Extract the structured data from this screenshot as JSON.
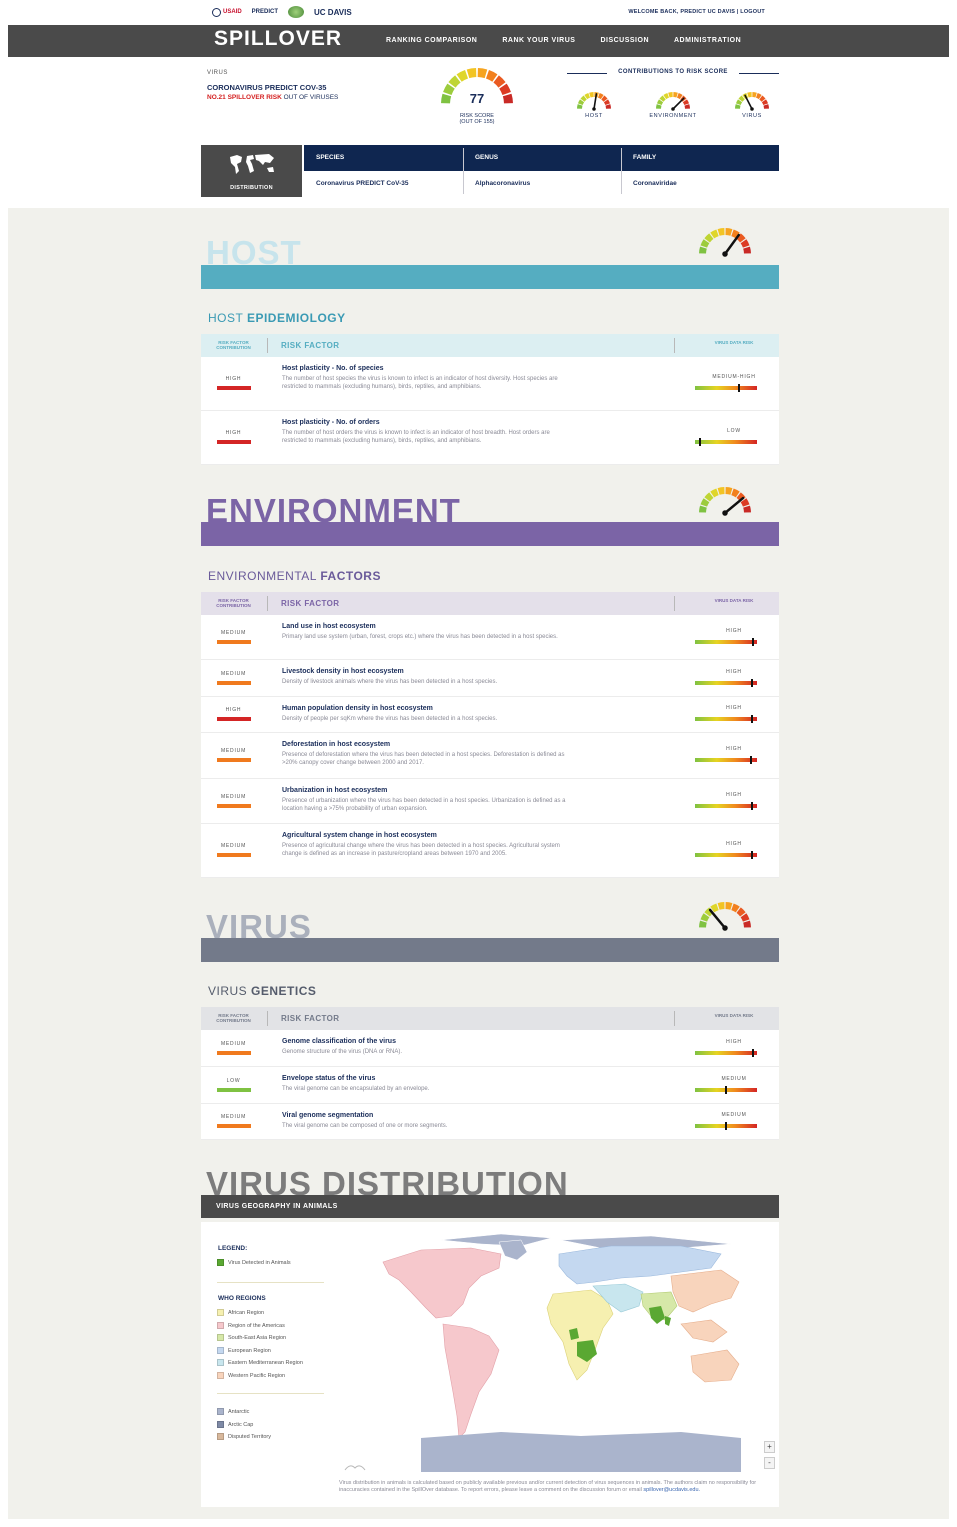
{
  "top": {
    "logos": [
      "USAID",
      "PREDICT",
      "UC DAVIS"
    ],
    "welcome": "WELCOME BACK, PREDICT UC DAVIS  |  LOGOUT"
  },
  "nav": {
    "brand": "SPILLOVER",
    "links": [
      "RANKING COMPARISON",
      "RANK YOUR VIRUS",
      "DISCUSSION",
      "ADMINISTRATION"
    ]
  },
  "virus": {
    "label": "VIRUS",
    "name": "CORONAVIRUS PREDICT COV-35",
    "rank_prefix": "NO.21 SPILLOVER RISK",
    "rank_suffix": " OUT OF VIRUSES",
    "score": "77",
    "score_label_1": "RISK SCORE",
    "score_label_2": "(OUT OF 155)"
  },
  "contributions": {
    "title": "CONTRIBUTIONS TO RISK SCORE",
    "items": [
      "HOST",
      "ENVIRONMENT",
      "VIRUS"
    ]
  },
  "taxonomy": {
    "distribution_label": "DISTRIBUTION",
    "headers": [
      "SPECIES",
      "GENUS",
      "FAMILY"
    ],
    "values": [
      "Coronavirus PREDICT CoV-35",
      "Alphacoronavirus",
      "Coronaviridae"
    ]
  },
  "table_headers": {
    "contribution": "RISK FACTOR CONTRIBUTION",
    "factor": "RISK FACTOR",
    "data_risk": "VIRUS DATA RISK"
  },
  "colors": {
    "host": "#55adc1",
    "environment": "#7b64a6",
    "virus": "#737a8a",
    "high": "#d42525",
    "medium": "#f07a1e",
    "low": "#7fc242"
  },
  "host": {
    "title": "HOST",
    "sub_a": "HOST ",
    "sub_b": "EPIDEMIOLOGY",
    "rows": [
      {
        "level": "HIGH",
        "title": "Host plasticity - No. of species",
        "desc": "The number of host species the virus is known to infect is an indicator of host diversity. Host species are restricted to mammals (excluding humans), birds, reptiles, and amphibians.",
        "risk": "MEDIUM-HIGH",
        "risk_value": 0.72
      },
      {
        "level": "HIGH",
        "title": "Host plasticity - No. of orders",
        "desc": "The number of host orders the virus is known to infect is an indicator of host breadth. Host orders are restricted to mammals (excluding humans), birds, reptiles, and amphibians.",
        "risk": "LOW",
        "risk_value": 0.06
      }
    ]
  },
  "environment": {
    "title": "ENVIRONMENT",
    "sub_a": "ENVIRONMENTAL ",
    "sub_b": "FACTORS",
    "rows": [
      {
        "level": "MEDIUM",
        "title": "Land use in host ecosystem",
        "desc": "Primary land use system (urban, forest, crops etc.) where the virus has been detected in a host species.",
        "risk": "HIGH",
        "risk_value": 0.95
      },
      {
        "level": "MEDIUM",
        "title": "Livestock density in host ecosystem",
        "desc": "Density of livestock animals where the virus has been detected in a host species.",
        "risk": "HIGH",
        "risk_value": 0.93
      },
      {
        "level": "HIGH",
        "title": "Human population density in host ecosystem",
        "desc": "Density of people per sqKm where the virus has been detected in a host species.",
        "risk": "HIGH",
        "risk_value": 0.94
      },
      {
        "level": "MEDIUM",
        "title": "Deforestation in host ecosystem",
        "desc": "Presence of deforestation where the virus has been detected in a host species. Deforestation is defined as >20% canopy cover change between 2000 and 2017.",
        "risk": "HIGH",
        "risk_value": 0.92
      },
      {
        "level": "MEDIUM",
        "title": "Urbanization in host ecosystem",
        "desc": "Presence of urbanization where the virus has been detected in a host species. Urbanization is defined as a location having a >75% probability of urban expansion.",
        "risk": "HIGH",
        "risk_value": 0.94
      },
      {
        "level": "MEDIUM",
        "title": "Agricultural system change in host ecosystem",
        "desc": "Presence of agricultural change where the virus has been detected in a host species. Agricultural system change is defined as an increase in pasture/cropland areas between 1970 and 2005.",
        "risk": "HIGH",
        "risk_value": 0.94
      }
    ]
  },
  "virus_section": {
    "title": "VIRUS",
    "sub_a": "VIRUS ",
    "sub_b": "GENETICS",
    "rows": [
      {
        "level": "MEDIUM",
        "title": "Genome classification of the virus",
        "desc": "Genome structure of the virus (DNA or RNA).",
        "risk": "HIGH",
        "risk_value": 0.95
      },
      {
        "level": "LOW",
        "title": "Envelope status of the virus",
        "desc": "The viral genome can be encapsulated by an envelope.",
        "risk": "MEDIUM",
        "risk_value": 0.5
      },
      {
        "level": "MEDIUM",
        "title": "Viral genome segmentation",
        "desc": "The viral genome can be composed of one or more segments.",
        "risk": "MEDIUM",
        "risk_value": 0.5
      }
    ]
  },
  "distribution": {
    "title": "VIRUS DISTRIBUTION",
    "band": "VIRUS GEOGRAPHY IN ANIMALS",
    "legend_title": "LEGEND:",
    "detected": "Virus Detected in Animals",
    "who_title": "WHO REGIONS",
    "regions": [
      {
        "label": "African Region",
        "color": "#f6f0b0"
      },
      {
        "label": "Region of the Americas",
        "color": "#f6c8cc"
      },
      {
        "label": "South-East Asia Region",
        "color": "#d6e8a8"
      },
      {
        "label": "European Region",
        "color": "#c4d8f0"
      },
      {
        "label": "Eastern Mediterranean Region",
        "color": "#c8e6ee"
      },
      {
        "label": "Western Pacific Region",
        "color": "#f8d4bc"
      }
    ],
    "other": [
      {
        "label": "Antarctic",
        "color": "#aab4cc"
      },
      {
        "label": "Arctic Cap",
        "color": "#7e8aa6"
      },
      {
        "label": "Disputed Territory",
        "color": "#d8b89c"
      }
    ],
    "zoom_in": "+",
    "zoom_out": "-",
    "disclaimer": "Virus distribution in animals is calculated based on publicly available previous and/or current detection of virus sequences in animals. The authors claim no responsibility for inaccuracies contained in the SpillOver database. To report errors, please leave a comment on the discussion forum or email",
    "email": "spillover@ucdavis.edu."
  }
}
